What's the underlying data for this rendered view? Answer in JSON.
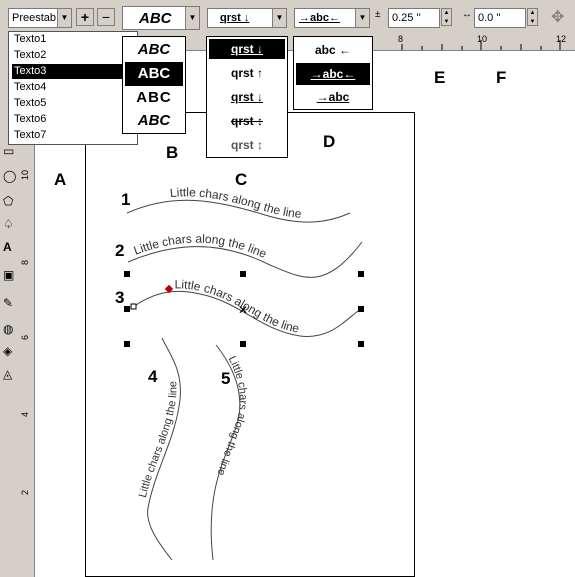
{
  "property_bar": {
    "preset_value": "Preestab",
    "add_label": "+",
    "remove_label": "−",
    "text_orientation_sample": "ABC",
    "vertical_placement_sample": "qrst ↓",
    "text_placement_sample": "→abc←",
    "distance_from_path": "0.25 ''",
    "horizontal_offset": "0.0 ''"
  },
  "preset_list": {
    "items": [
      "Texto1",
      "Texto2",
      "Texto3",
      "Texto4",
      "Texto5",
      "Texto6",
      "Texto7"
    ],
    "selected_index": 2
  },
  "orientation_options": {
    "items": [
      "ABC",
      "ABC",
      "ABC",
      "ABC"
    ],
    "selected_index": 1
  },
  "vertical_placement_options": {
    "items": [
      "qrst ↓",
      "qrst ↑",
      "qrst ↓",
      "qrst ↕",
      "qrst ↕"
    ],
    "selected_index": 0
  },
  "text_placement_options": {
    "items": [
      "abc ←",
      "→abc←",
      "→abc"
    ],
    "selected_index": 1
  },
  "ruler": {
    "h_ticks": [
      "8",
      "10",
      "12"
    ],
    "v_ticks": [
      "10",
      "8",
      "6",
      "4",
      "2"
    ]
  },
  "labels": {
    "A": "A",
    "B": "B",
    "C": "C",
    "D": "D",
    "E": "E",
    "F": "F",
    "n1": "1",
    "n2": "2",
    "n3": "3",
    "n4": "4",
    "n5": "5"
  },
  "path_texts": {
    "t1": "Little chars along the line",
    "t2": "Little chars along the line",
    "t3": "Little chars along the line",
    "t4": "Little chars along the line",
    "t5": "Little chars along the line"
  }
}
